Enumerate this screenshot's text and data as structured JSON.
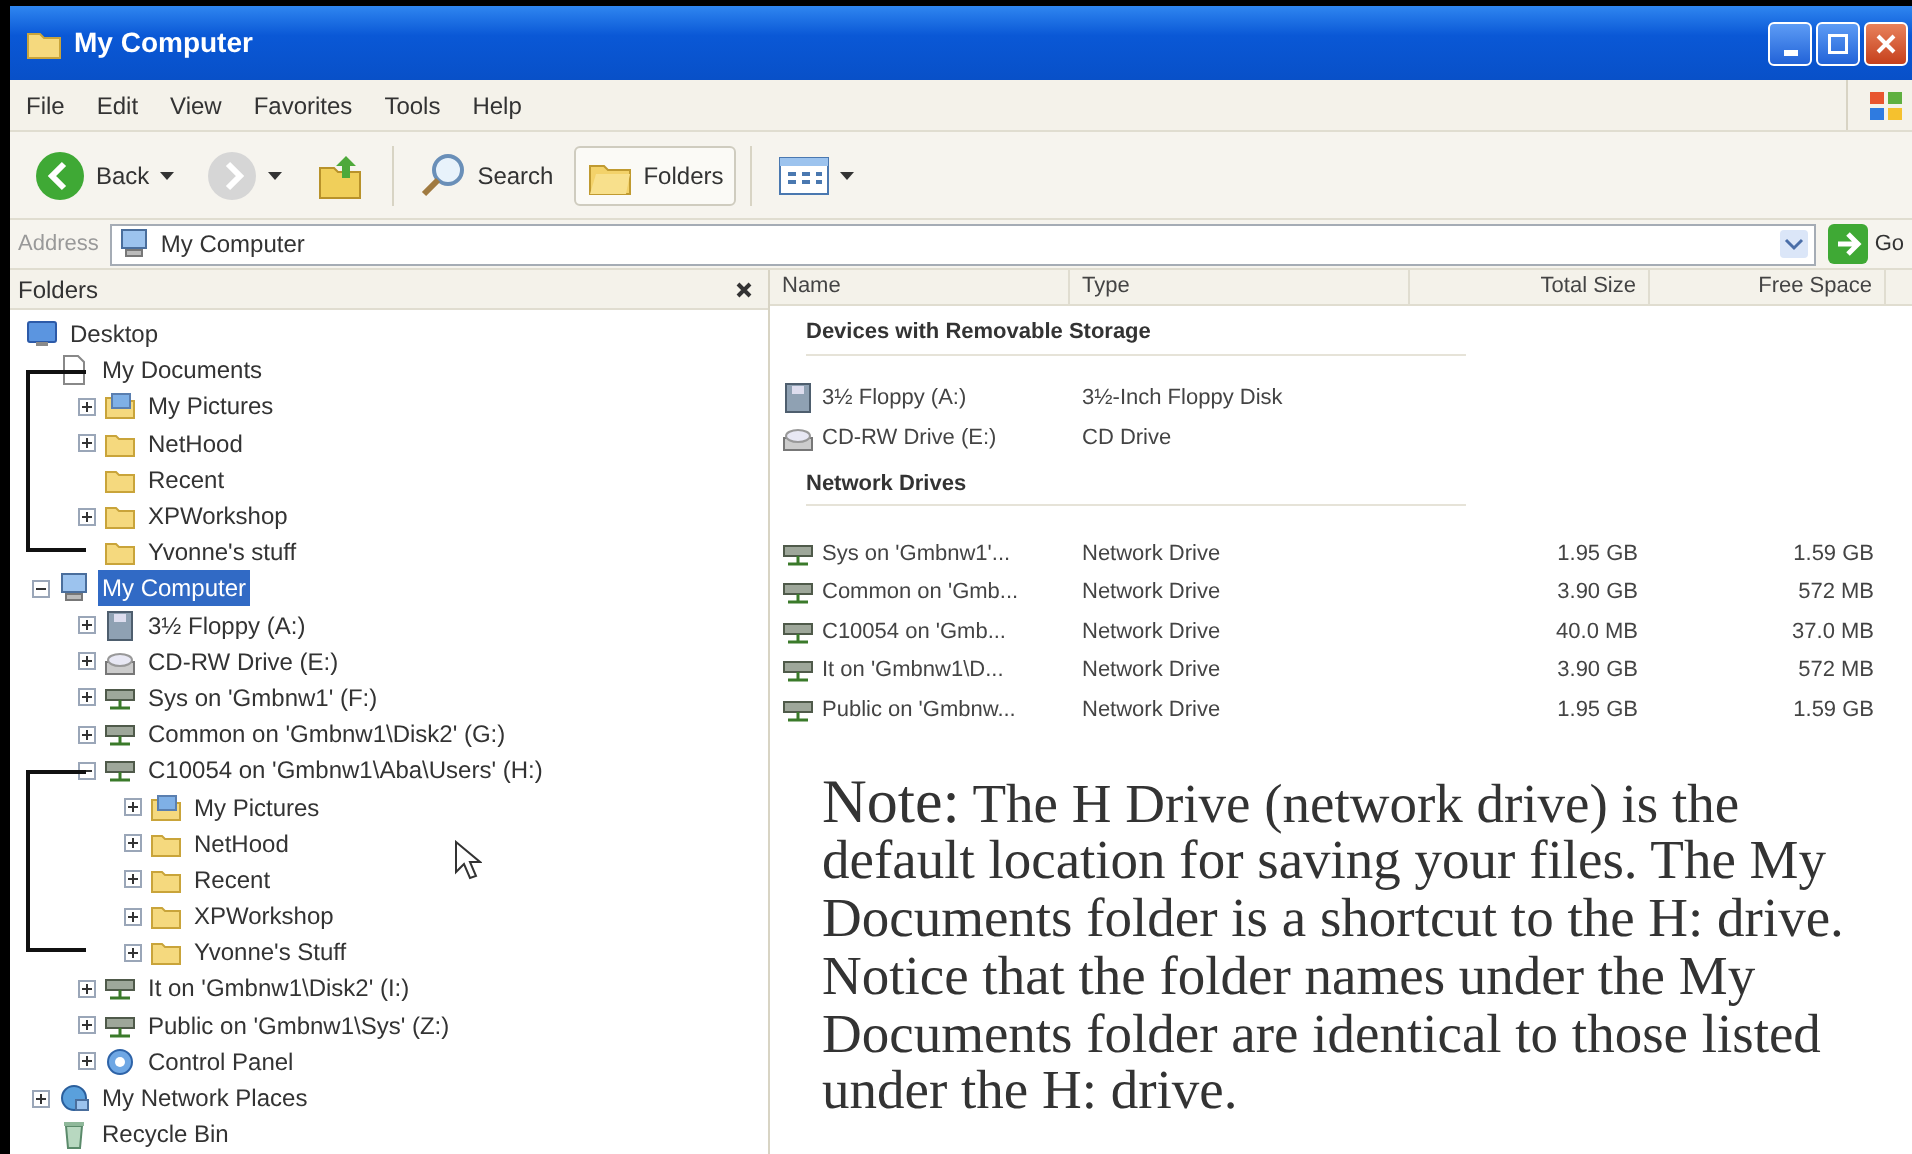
{
  "window": {
    "title": "My Computer"
  },
  "menu": [
    "File",
    "Edit",
    "View",
    "Favorites",
    "Tools",
    "Help"
  ],
  "toolbar": {
    "back": {
      "label": "Back",
      "disabled": false
    },
    "forward": {
      "disabled": true
    },
    "search": {
      "label": "Search"
    },
    "folders": {
      "label": "Folders",
      "selected": true
    }
  },
  "address": {
    "label": "Address",
    "value": "My Computer",
    "go": "Go"
  },
  "folders_pane": {
    "title": "Folders",
    "tree": [
      {
        "kind": "desktop",
        "label": "Desktop",
        "selected": false,
        "children": [
          {
            "kind": "documents",
            "label": "My Documents",
            "selected": false,
            "bracketed": true,
            "children": [
              {
                "kind": "pictures",
                "label": "My Pictures",
                "selected": false,
                "expanded": false
              },
              {
                "kind": "folder",
                "label": "NetHood",
                "selected": false,
                "expanded": false
              },
              {
                "kind": "folder",
                "label": "Recent",
                "selected": false
              },
              {
                "kind": "folder",
                "label": "XPWorkshop",
                "selected": false,
                "expanded": false
              },
              {
                "kind": "folder",
                "label": "Yvonne's stuff",
                "selected": false
              }
            ]
          },
          {
            "kind": "computer",
            "label": "My Computer",
            "selected": true,
            "expanded": true,
            "children": [
              {
                "kind": "floppy",
                "label": "3½ Floppy (A:)",
                "selected": false,
                "expanded": false
              },
              {
                "kind": "cdrom",
                "label": "CD-RW Drive (E:)",
                "selected": false,
                "expanded": false
              },
              {
                "kind": "netdrive",
                "label": "Sys on 'Gmbnw1' (F:)",
                "selected": false,
                "expanded": false
              },
              {
                "kind": "netdrive",
                "label": "Common on 'Gmbnw1\\Disk2' (G:)",
                "selected": false,
                "expanded": false
              },
              {
                "kind": "netdrive",
                "label": "C10054 on 'Gmbnw1\\Aba\\Users' (H:)",
                "selected": false,
                "expanded": true,
                "bracketed": true,
                "children": [
                  {
                    "kind": "pictures",
                    "label": "My Pictures",
                    "selected": false,
                    "expanded": false
                  },
                  {
                    "kind": "folder",
                    "label": "NetHood",
                    "selected": false,
                    "expanded": false
                  },
                  {
                    "kind": "folder",
                    "label": "Recent",
                    "selected": false,
                    "expanded": false
                  },
                  {
                    "kind": "folder",
                    "label": "XPWorkshop",
                    "selected": false,
                    "expanded": false
                  },
                  {
                    "kind": "folder",
                    "label": "Yvonne's Stuff",
                    "selected": false,
                    "expanded": false
                  }
                ]
              },
              {
                "kind": "netdrive",
                "label": "It on 'Gmbnw1\\Disk2' (I:)",
                "selected": false,
                "expanded": false
              },
              {
                "kind": "netdrive",
                "label": "Public on 'Gmbnw1\\Sys' (Z:)",
                "selected": false,
                "expanded": false
              },
              {
                "kind": "control",
                "label": "Control Panel",
                "selected": false,
                "expanded": false
              }
            ]
          },
          {
            "kind": "network",
            "label": "My Network Places",
            "selected": false,
            "expanded": false
          },
          {
            "kind": "recycle",
            "label": "Recycle Bin",
            "selected": false
          }
        ]
      }
    ]
  },
  "list": {
    "columns": [
      "Name",
      "Type",
      "Total Size",
      "Free Space"
    ],
    "groups": [
      {
        "heading": "Devices with Removable Storage",
        "items": [
          {
            "kind": "floppy",
            "name": "3½ Floppy (A:)",
            "type": "3½-Inch Floppy Disk"
          },
          {
            "kind": "cdrom",
            "name": "CD-RW Drive (E:)",
            "type": "CD Drive"
          }
        ]
      },
      {
        "heading": "Network Drives",
        "items": [
          {
            "kind": "netdrive",
            "name": "Sys on 'Gmbnw1'...",
            "type": "Network Drive",
            "total_size": "1.95 GB",
            "free_space": "1.59 GB"
          },
          {
            "kind": "netdrive",
            "name": "Common on 'Gmb...",
            "type": "Network Drive",
            "total_size": "3.90 GB",
            "free_space": "572 MB"
          },
          {
            "kind": "netdrive",
            "name": "C10054 on 'Gmb...",
            "type": "Network Drive",
            "total_size": "40.0 MB",
            "free_space": "37.0 MB"
          },
          {
            "kind": "netdrive",
            "name": "It on 'Gmbnw1\\D...",
            "type": "Network Drive",
            "total_size": "3.90 GB",
            "free_space": "572 MB"
          },
          {
            "kind": "netdrive",
            "name": "Public on 'Gmbnw...",
            "type": "Network Drive",
            "total_size": "1.95 GB",
            "free_space": "1.59 GB"
          }
        ]
      }
    ]
  },
  "note": {
    "label": "Note:",
    "text": "The H Drive (network drive) is the default location for saving your files. The My Documents folder is a shortcut to the H: drive. Notice that the folder names under the My Documents folder are identical to those listed under the H: drive."
  }
}
